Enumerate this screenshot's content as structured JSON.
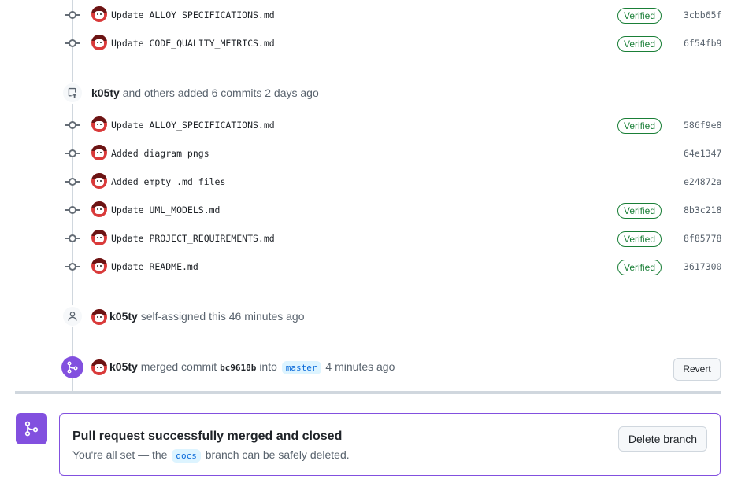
{
  "commit_group_top": [
    {
      "message": "Update ALLOY_SPECIFICATIONS.md",
      "verified": "Verified",
      "sha": "3cbb65f"
    },
    {
      "message": "Update CODE_QUALITY_METRICS.md",
      "verified": "Verified",
      "sha": "6f54fb9"
    }
  ],
  "push_event": {
    "actor": "k05ty",
    "text": "and others added 6 commits",
    "when": "2 days ago"
  },
  "commit_group_main": [
    {
      "message": "Update ALLOY_SPECIFICATIONS.md",
      "verified": "Verified",
      "sha": "586f9e8"
    },
    {
      "message": "Added diagram pngs",
      "verified": "",
      "sha": "64e1347"
    },
    {
      "message": "Added empty .md files",
      "verified": "",
      "sha": "e24872a"
    },
    {
      "message": "Update UML_MODELS.md",
      "verified": "Verified",
      "sha": "8b3c218"
    },
    {
      "message": "Update PROJECT_REQUIREMENTS.md",
      "verified": "Verified",
      "sha": "8f85778"
    },
    {
      "message": "Update README.md",
      "verified": "Verified",
      "sha": "3617300"
    }
  ],
  "assign_event": {
    "actor": "k05ty",
    "text": "self-assigned this",
    "when": "46 minutes ago"
  },
  "merge_event": {
    "actor": "k05ty",
    "text": "merged commit",
    "commit": "bc9618b",
    "into": "into",
    "branch": "master",
    "when": "4 minutes ago",
    "revert_label": "Revert"
  },
  "merged_box": {
    "title": "Pull request successfully merged and closed",
    "sub_prefix": "You're all set — the",
    "branch": "docs",
    "sub_suffix": "branch can be safely deleted.",
    "delete_label": "Delete branch"
  },
  "colors": {
    "verified_green": "#1a7f37",
    "merged_purple": "#8250df",
    "timeline_gray": "#d0d7de",
    "branch_blue": "#0969da"
  },
  "icons": {
    "commit": "git-commit-icon",
    "push": "repo-push-icon",
    "person": "person-icon",
    "merge": "git-merge-icon"
  }
}
